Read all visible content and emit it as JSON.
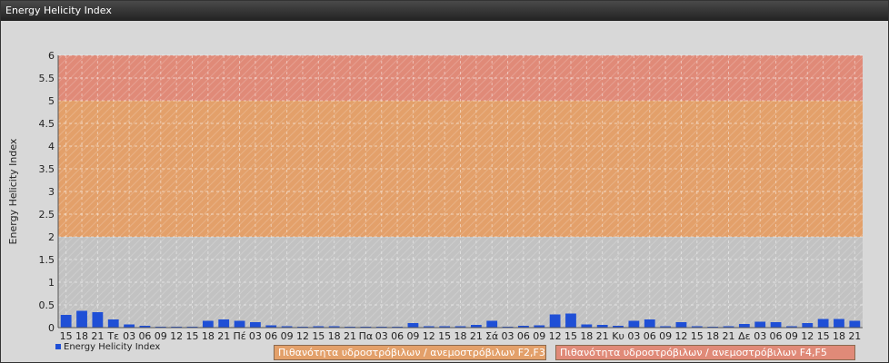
{
  "window": {
    "title": "Energy Helicity Index"
  },
  "zones": [
    {
      "label": "Πιθανότητα υδροστρόβιλων / ανεμοστρόβιλων F2,F3",
      "from": 2,
      "to": 5,
      "color": "#e3a06a"
    },
    {
      "label": "Πιθανότητα υδροστρόβιλων / ανεμοστρόβιλων F4,F5",
      "from": 5,
      "to": 6,
      "color": "#e08a78"
    }
  ],
  "chart_data": {
    "type": "bar",
    "title": "",
    "ylabel": "Energy Helicity Index",
    "xlabel": "",
    "ylim": [
      0,
      6
    ],
    "yticks": [
      0,
      0.5,
      1,
      1.5,
      2,
      2.5,
      3,
      3.5,
      4,
      4.5,
      5,
      5.5,
      6
    ],
    "grid": true,
    "legend_position": "bottom-left",
    "categories": [
      "15",
      "18",
      "21",
      "Τε",
      "03",
      "06",
      "09",
      "12",
      "15",
      "18",
      "21",
      "Πέ",
      "03",
      "06",
      "09",
      "12",
      "15",
      "18",
      "21",
      "Πα",
      "03",
      "06",
      "09",
      "12",
      "15",
      "18",
      "21",
      "Σά",
      "03",
      "06",
      "09",
      "12",
      "15",
      "18",
      "21",
      "Κυ",
      "03",
      "06",
      "09",
      "12",
      "15",
      "18",
      "21",
      "Δε",
      "03",
      "06",
      "09",
      "12",
      "15",
      "18",
      "21"
    ],
    "series": [
      {
        "name": "Energy Helicity Index",
        "color": "#1f4fd6",
        "values": [
          0.28,
          0.37,
          0.34,
          0.18,
          0.07,
          0.04,
          0.02,
          0.02,
          0.02,
          0.15,
          0.18,
          0.15,
          0.12,
          0.05,
          0.03,
          0.02,
          0.03,
          0.03,
          0.02,
          0.02,
          0.02,
          0.02,
          0.1,
          0.03,
          0.03,
          0.03,
          0.06,
          0.15,
          0.02,
          0.04,
          0.05,
          0.29,
          0.31,
          0.07,
          0.06,
          0.04,
          0.15,
          0.18,
          0.03,
          0.12,
          0.03,
          0.02,
          0.03,
          0.08,
          0.13,
          0.12,
          0.03,
          0.1,
          0.19,
          0.19,
          0.15
        ]
      }
    ]
  }
}
